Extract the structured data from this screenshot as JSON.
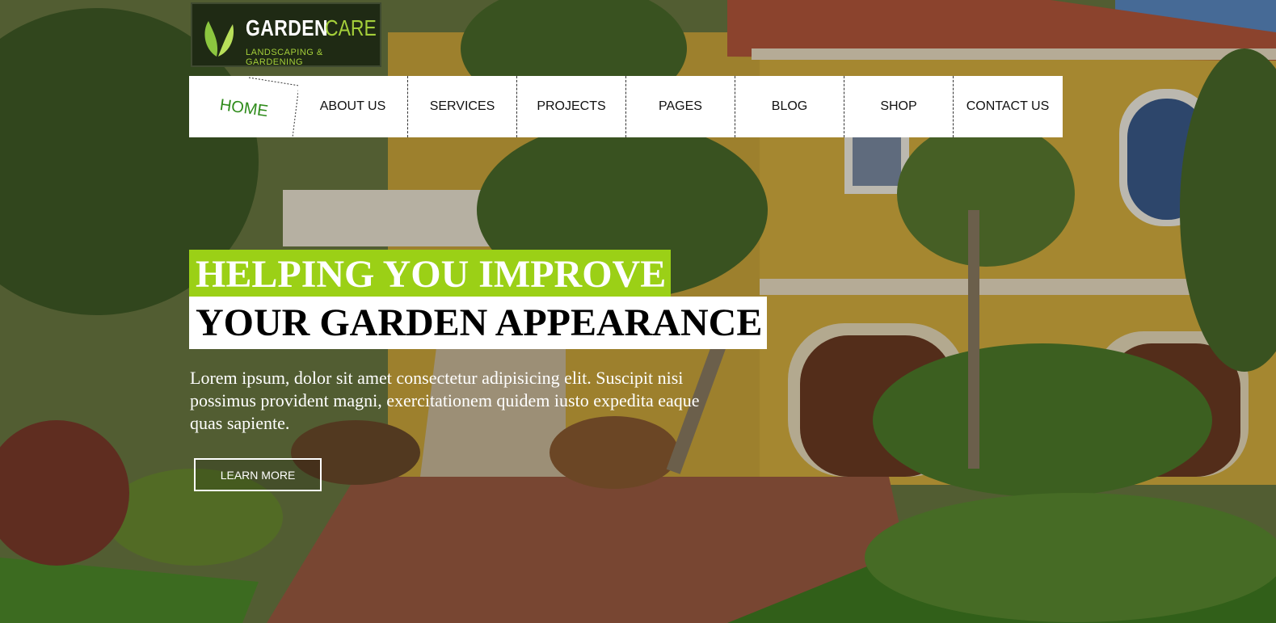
{
  "logo": {
    "brand_primary": "GARDEN",
    "brand_secondary": "CARE",
    "tagline": "LANDSCAPING & GARDENING",
    "icon": "leaf-icon"
  },
  "nav": {
    "items": [
      {
        "label": "HOME",
        "active": true
      },
      {
        "label": "ABOUT US"
      },
      {
        "label": "SERVICES"
      },
      {
        "label": "PROJECTS"
      },
      {
        "label": "PAGES"
      },
      {
        "label": "BLOG"
      },
      {
        "label": "SHOP"
      },
      {
        "label": "CONTACT US"
      }
    ]
  },
  "hero": {
    "headline_line1": "HELPING YOU IMPROVE",
    "headline_line2": "YOUR GARDEN APPEARANCE",
    "description": "Lorem ipsum, dolor sit amet consectetur adipisicing elit. Suscipit nisi possimus provident magni, exercitationem quidem iusto expedita eaque quas sapiente.",
    "cta_label": "LEARN MORE"
  },
  "colors": {
    "accent": "#9bd016",
    "active_nav": "#2e8b1a",
    "logo_bg": "#1f2a14"
  }
}
